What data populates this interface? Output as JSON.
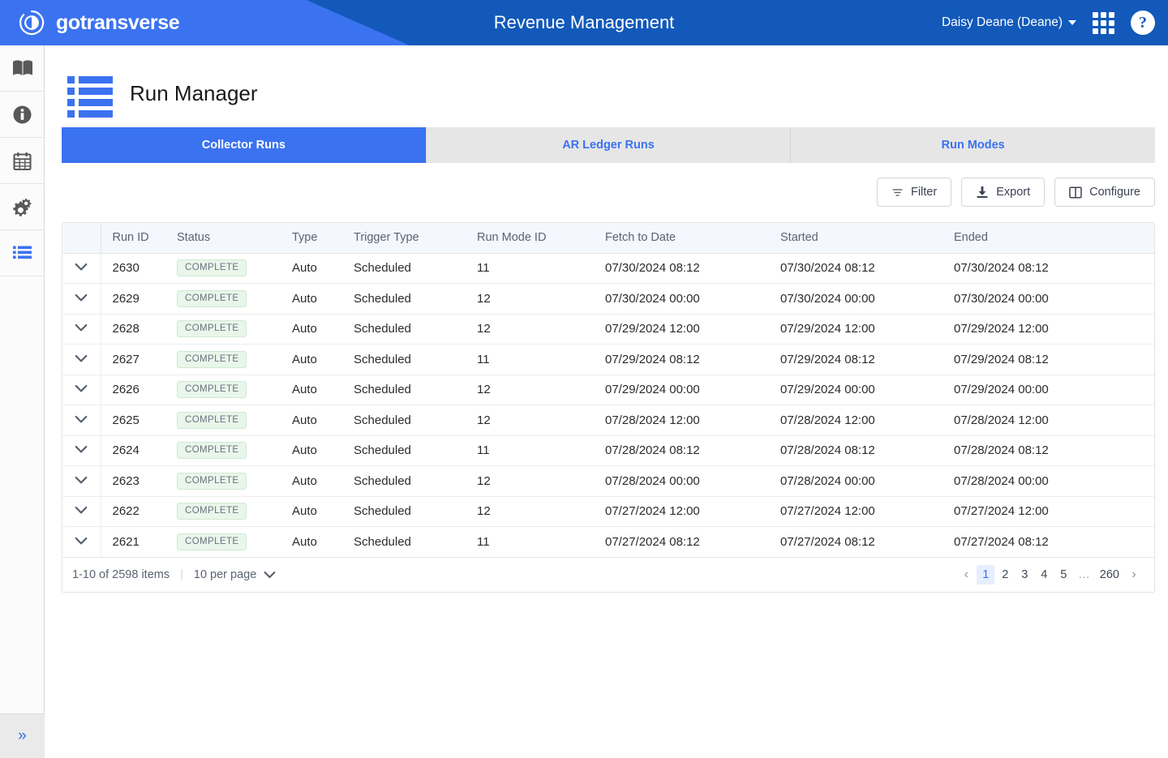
{
  "header": {
    "brand": "gotransverse",
    "brand_logo_icon": "circle-swoosh-logo",
    "title": "Revenue Management",
    "user": "Daisy Deane (Deane)",
    "apps_icon": "grid-apps-icon",
    "help_icon": "help-question-icon",
    "accent_dark": "#1259ba",
    "accent_light": "#3b72f0"
  },
  "sidebar": {
    "items": [
      {
        "name": "book-icon",
        "label": "Catalog"
      },
      {
        "name": "info-icon",
        "label": "Information"
      },
      {
        "name": "calendar-icon",
        "label": "Calendar"
      },
      {
        "name": "gears-icon",
        "label": "Settings"
      },
      {
        "name": "list-icon",
        "label": "Run Manager",
        "active": true
      }
    ],
    "toggle_icon": "double-chevron-right-icon",
    "toggle_label": "»"
  },
  "page": {
    "title": "Run Manager",
    "icon": "list-blue-icon"
  },
  "tabs": [
    {
      "label": "Collector Runs",
      "active": true
    },
    {
      "label": "AR Ledger Runs",
      "active": false
    },
    {
      "label": "Run Modes",
      "active": false
    }
  ],
  "toolbar": {
    "filter_label": "Filter",
    "filter_icon": "filter-icon",
    "export_label": "Export",
    "export_icon": "download-icon",
    "configure_label": "Configure",
    "configure_icon": "columns-icon"
  },
  "table": {
    "columns": [
      "Run ID",
      "Status",
      "Type",
      "Trigger Type",
      "Run Mode ID",
      "Fetch to Date",
      "Started",
      "Ended"
    ],
    "rows": [
      {
        "run_id": "2630",
        "status": "COMPLETE",
        "type": "Auto",
        "trigger": "Scheduled",
        "mode": "11",
        "fetch": "07/30/2024 08:12",
        "started": "07/30/2024 08:12",
        "ended": "07/30/2024 08:12"
      },
      {
        "run_id": "2629",
        "status": "COMPLETE",
        "type": "Auto",
        "trigger": "Scheduled",
        "mode": "12",
        "fetch": "07/30/2024 00:00",
        "started": "07/30/2024 00:00",
        "ended": "07/30/2024 00:00"
      },
      {
        "run_id": "2628",
        "status": "COMPLETE",
        "type": "Auto",
        "trigger": "Scheduled",
        "mode": "12",
        "fetch": "07/29/2024 12:00",
        "started": "07/29/2024 12:00",
        "ended": "07/29/2024 12:00"
      },
      {
        "run_id": "2627",
        "status": "COMPLETE",
        "type": "Auto",
        "trigger": "Scheduled",
        "mode": "11",
        "fetch": "07/29/2024 08:12",
        "started": "07/29/2024 08:12",
        "ended": "07/29/2024 08:12"
      },
      {
        "run_id": "2626",
        "status": "COMPLETE",
        "type": "Auto",
        "trigger": "Scheduled",
        "mode": "12",
        "fetch": "07/29/2024 00:00",
        "started": "07/29/2024 00:00",
        "ended": "07/29/2024 00:00"
      },
      {
        "run_id": "2625",
        "status": "COMPLETE",
        "type": "Auto",
        "trigger": "Scheduled",
        "mode": "12",
        "fetch": "07/28/2024 12:00",
        "started": "07/28/2024 12:00",
        "ended": "07/28/2024 12:00"
      },
      {
        "run_id": "2624",
        "status": "COMPLETE",
        "type": "Auto",
        "trigger": "Scheduled",
        "mode": "11",
        "fetch": "07/28/2024 08:12",
        "started": "07/28/2024 08:12",
        "ended": "07/28/2024 08:12"
      },
      {
        "run_id": "2623",
        "status": "COMPLETE",
        "type": "Auto",
        "trigger": "Scheduled",
        "mode": "12",
        "fetch": "07/28/2024 00:00",
        "started": "07/28/2024 00:00",
        "ended": "07/28/2024 00:00"
      },
      {
        "run_id": "2622",
        "status": "COMPLETE",
        "type": "Auto",
        "trigger": "Scheduled",
        "mode": "12",
        "fetch": "07/27/2024 12:00",
        "started": "07/27/2024 12:00",
        "ended": "07/27/2024 12:00"
      },
      {
        "run_id": "2621",
        "status": "COMPLETE",
        "type": "Auto",
        "trigger": "Scheduled",
        "mode": "11",
        "fetch": "07/27/2024 08:12",
        "started": "07/27/2024 08:12",
        "ended": "07/27/2024 08:12"
      }
    ],
    "status_badge_bg": "#e9f6ea",
    "status_badge_border": "#cfe9d2"
  },
  "pager": {
    "range_text": "1-10 of 2598 items",
    "separator": "|",
    "per_page_label": "10 per page",
    "prev_label": "‹",
    "next_label": "›",
    "pages": [
      "1",
      "2",
      "3",
      "4",
      "5",
      "…",
      "260"
    ],
    "current_page": "1"
  }
}
